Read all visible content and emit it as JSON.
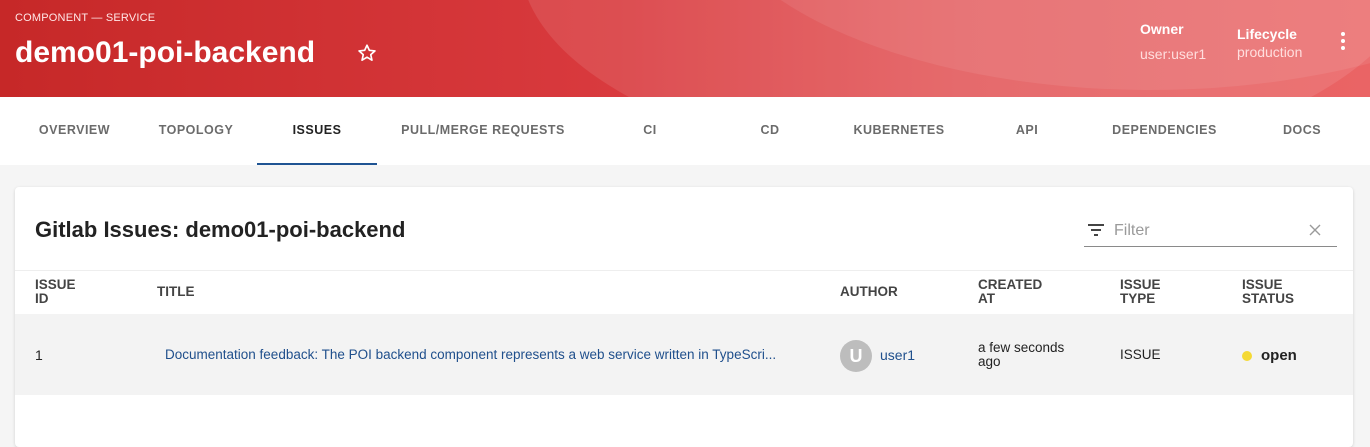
{
  "header": {
    "kind": "COMPONENT — SERVICE",
    "title": "demo01-poi-backend",
    "owner_label": "Owner",
    "owner_value": "user:user1",
    "lifecycle_label": "Lifecycle",
    "lifecycle_value": "production",
    "icons": [
      "star-icon",
      "more-vert-icon"
    ]
  },
  "tabs": [
    {
      "label": "OVERVIEW",
      "active": false
    },
    {
      "label": "TOPOLOGY",
      "active": false
    },
    {
      "label": "ISSUES",
      "active": true
    },
    {
      "label": "PULL/MERGE REQUESTS",
      "active": false
    },
    {
      "label": "CI",
      "active": false
    },
    {
      "label": "CD",
      "active": false
    },
    {
      "label": "KUBERNETES",
      "active": false
    },
    {
      "label": "API",
      "active": false
    },
    {
      "label": "DEPENDENCIES",
      "active": false
    },
    {
      "label": "DOCS",
      "active": false
    }
  ],
  "issues": {
    "title": "Gitlab Issues: demo01-poi-backend",
    "filter_placeholder": "Filter",
    "columns": {
      "issue_id_1": "ISSUE",
      "issue_id_2": "ID",
      "title": "TITLE",
      "author": "AUTHOR",
      "created_1": "CREATED",
      "created_2": "AT",
      "type_1": "ISSUE",
      "type_2": "TYPE",
      "status_1": "ISSUE",
      "status_2": "STATUS"
    },
    "rows": [
      {
        "id": "1",
        "title": "Documentation feedback: The POI backend component represents a web service written in TypeScri...",
        "author_initial": "U",
        "author": "user1",
        "created_1": "a few seconds",
        "created_2": "ago",
        "type": "ISSUE",
        "status": "open"
      }
    ]
  },
  "colors": {
    "header_start": "#c62828",
    "header_end": "#ea6465",
    "tab_indicator": "#1f5493",
    "link": "#1f4f8c",
    "status_open": "#f4d934"
  }
}
